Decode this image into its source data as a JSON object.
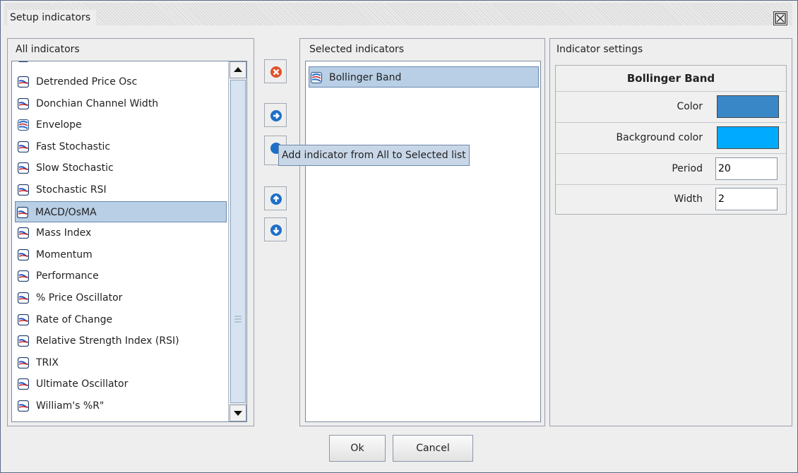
{
  "dialog": {
    "title": "Setup indicators"
  },
  "all_panel": {
    "title": "All indicators",
    "items": [
      {
        "label": "Detrended Price Osc",
        "icon": "oscillator-icon"
      },
      {
        "label": "Donchian Channel Width",
        "icon": "oscillator-icon"
      },
      {
        "label": "Envelope",
        "icon": "band-icon"
      },
      {
        "label": "Fast Stochastic",
        "icon": "oscillator-icon"
      },
      {
        "label": "Slow Stochastic",
        "icon": "oscillator-icon"
      },
      {
        "label": "Stochastic RSI",
        "icon": "oscillator-icon"
      },
      {
        "label": "MACD/OsMA",
        "icon": "oscillator-icon",
        "selected": true
      },
      {
        "label": "Mass Index",
        "icon": "oscillator-icon"
      },
      {
        "label": "Momentum",
        "icon": "oscillator-icon"
      },
      {
        "label": "Performance",
        "icon": "oscillator-icon"
      },
      {
        "label": "% Price Oscillator",
        "icon": "oscillator-icon"
      },
      {
        "label": "Rate of Change",
        "icon": "oscillator-icon"
      },
      {
        "label": "Relative Strength Index (RSI)",
        "icon": "oscillator-icon"
      },
      {
        "label": "TRIX",
        "icon": "oscillator-icon"
      },
      {
        "label": "Ultimate Oscillator",
        "icon": "oscillator-icon"
      },
      {
        "label": "William's %R\"",
        "icon": "oscillator-icon"
      }
    ]
  },
  "selected_panel": {
    "title": "Selected indicators",
    "items": [
      {
        "label": "Bollinger Band",
        "icon": "band-icon",
        "selected": true
      }
    ]
  },
  "tooltip": {
    "text": "Add indicator from All to Selected list"
  },
  "settings_panel": {
    "title": "Indicator settings",
    "header": "Bollinger Band",
    "color_label": "Color",
    "color_value": "#3a87c8",
    "background_label": "Background color",
    "background_value": "#00aaff",
    "period_label": "Period",
    "period_value": "20",
    "width_label": "Width",
    "width_value": "2"
  },
  "buttons": {
    "ok": "Ok",
    "cancel": "Cancel"
  },
  "colors": {
    "selection": "#b8cfe5",
    "accent_button": "#1e6fc8",
    "remove_button": "#e0502c"
  }
}
